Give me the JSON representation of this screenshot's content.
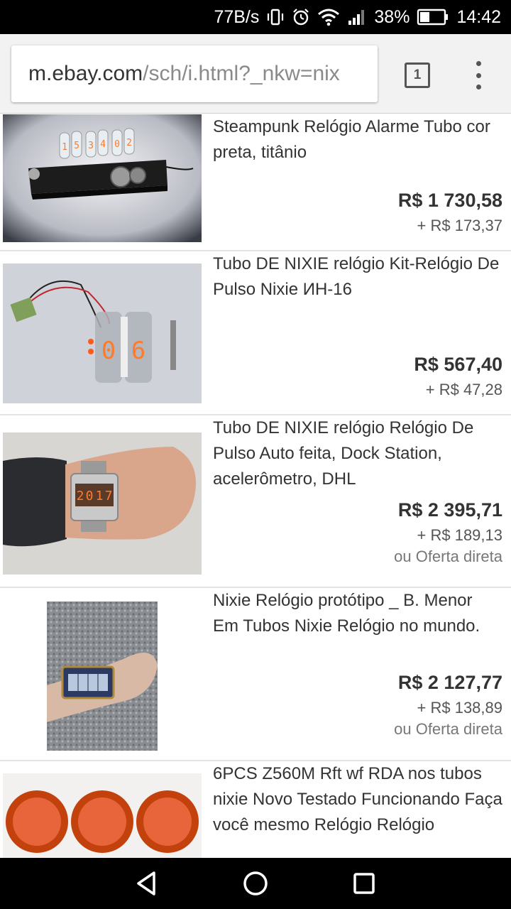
{
  "status": {
    "speed": "77B/s",
    "battery": "38%",
    "time": "14:42"
  },
  "browser": {
    "url_host": "m.ebay.com",
    "url_path": "/sch/i.html?_nkw=nix",
    "tab_count": "1"
  },
  "items": [
    {
      "title": "Steampunk Relógio Alarme Tubo cor preta, titânio",
      "price": "R$ 1 730,58",
      "shipping": "+ R$ 173,37",
      "offer": ""
    },
    {
      "title": "Tubo DE NIXIE relógio Kit-Relógio De Pulso Nixie ИН-16",
      "price": "R$ 567,40",
      "shipping": "+ R$ 47,28",
      "offer": ""
    },
    {
      "title": "Tubo DE NIXIE relógio Relógio De Pulso Auto feita, Dock Station, acelerômetro, DHL",
      "price": "R$ 2 395,71",
      "shipping": "+ R$ 189,13",
      "offer": "ou Oferta direta"
    },
    {
      "title": "Nixie Relógio protótipo _ B. Menor Em Tubos Nixie Relógio no mundo.",
      "price": "R$ 2 127,77",
      "shipping": "+ R$ 138,89",
      "offer": "ou Oferta direta"
    },
    {
      "title": "6PCS Z560M Rft wf RDA nos tubos nixie Novo Testado Funcionando Faça você mesmo Relógio Relógio",
      "price": "",
      "shipping": "",
      "offer": ""
    }
  ],
  "thumb_digits": {
    "item1": [
      "1",
      "5",
      "3",
      "4",
      "0",
      "2"
    ],
    "item2": [
      "0",
      "6"
    ],
    "item3": [
      "2",
      "0",
      "1",
      "7"
    ]
  },
  "icons": {
    "wifi": "wifi-icon",
    "signal": "signal-icon",
    "battery": "battery-icon",
    "vibrate": "vibrate-icon",
    "alarm": "alarm-icon",
    "back": "back-icon",
    "home": "home-icon",
    "recents": "recents-icon"
  },
  "colors": {
    "status_bar": "#000000",
    "nav_bar": "#000000",
    "toolbar": "#f2f2f2",
    "nixie_glow": "#ff7a2a"
  }
}
